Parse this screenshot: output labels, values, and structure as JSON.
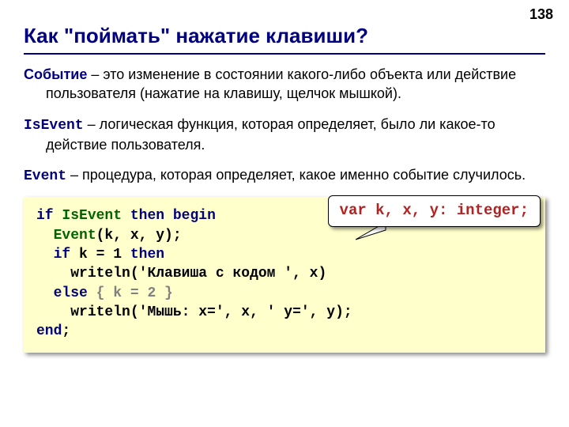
{
  "page_number": "138",
  "title": "Как \"поймать\" нажатие клавиши?",
  "paras": [
    {
      "term": "Событие",
      "term_class": "term-blue",
      "text": " – это изменение в состоянии какого-либо объекта или действие пользователя (нажатие на клавишу, щелчок мышкой)."
    },
    {
      "term": "IsEvent",
      "term_class": "term-mono",
      "text": " – логическая функция, которая определяет, было ли какое-то действие пользователя."
    },
    {
      "term": "Event",
      "term_class": "term-mono",
      "text": " – процедура, которая определяет, какое именно событие случилось."
    }
  ],
  "code": {
    "l1": {
      "kw1": "if",
      "id1": "IsEvent",
      "kw2": "then begin"
    },
    "l2": {
      "id1": "Event",
      "args": "(k, x, y);"
    },
    "l3": {
      "kw1": "if",
      "rest": " k = 1 ",
      "kw2": "then"
    },
    "l4": {
      "call": "writeln",
      "str": "('Клавиша с кодом ', x)"
    },
    "l5": {
      "kw1": "else",
      "cmt": "{ k = 2 }"
    },
    "l6": {
      "call": "writeln",
      "str": "('Мышь: x=', x, ' y=', y);"
    },
    "l7": {
      "kw1": "end",
      "semi": ";"
    }
  },
  "callout": "var k, x, y: integer;"
}
